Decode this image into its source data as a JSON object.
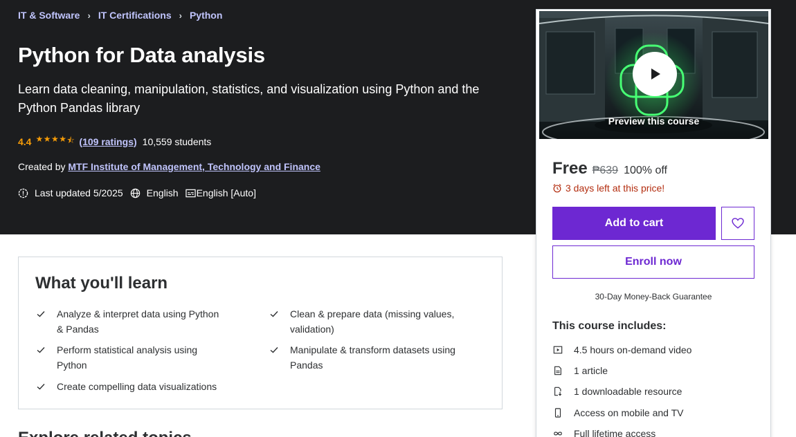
{
  "breadcrumb": [
    "IT & Software",
    "IT Certifications",
    "Python"
  ],
  "course": {
    "title": "Python for Data analysis",
    "subtitle": "Learn data cleaning, manipulation, statistics, and visualization using Python and the Python Pandas library",
    "rating": "4.4",
    "stars": 4.4,
    "ratings_count": "(109 ratings)",
    "students": "10,559 students",
    "created_by_label": "Created by",
    "instructor": "MTF Institute of Management, Technology and Finance",
    "last_updated": "Last updated 5/2025",
    "language": "English",
    "captions": "English [Auto]"
  },
  "learn": {
    "title": "What you'll learn",
    "items": [
      "Analyze & interpret data using Python & Pandas",
      "Clean & prepare data (missing values, validation)",
      "Perform statistical analysis using Python",
      "Manipulate & transform datasets using Pandas",
      "Create compelling data visualizations"
    ]
  },
  "next_section": {
    "title": "Explore related topics"
  },
  "sidebar": {
    "preview_label": "Preview this course",
    "price": "Free",
    "original_price": "₱639",
    "discount": "100% off",
    "urgency": "3 days left at this price!",
    "add_to_cart": "Add to cart",
    "enroll": "Enroll now",
    "guarantee": "30-Day Money-Back Guarantee",
    "includes_title": "This course includes:",
    "includes": [
      {
        "icon": "video-icon",
        "label": "4.5 hours on-demand video"
      },
      {
        "icon": "article-icon",
        "label": "1 article"
      },
      {
        "icon": "download-icon",
        "label": "1 downloadable resource"
      },
      {
        "icon": "mobile-icon",
        "label": "Access on mobile and TV"
      },
      {
        "icon": "infinity-icon",
        "label": "Full lifetime access"
      }
    ]
  },
  "colors": {
    "hero_bg": "#1c1d1f",
    "link": "#c0c4fc",
    "star": "#f69c08",
    "primary": "#6d28d2",
    "urgency": "#b32d0f"
  }
}
